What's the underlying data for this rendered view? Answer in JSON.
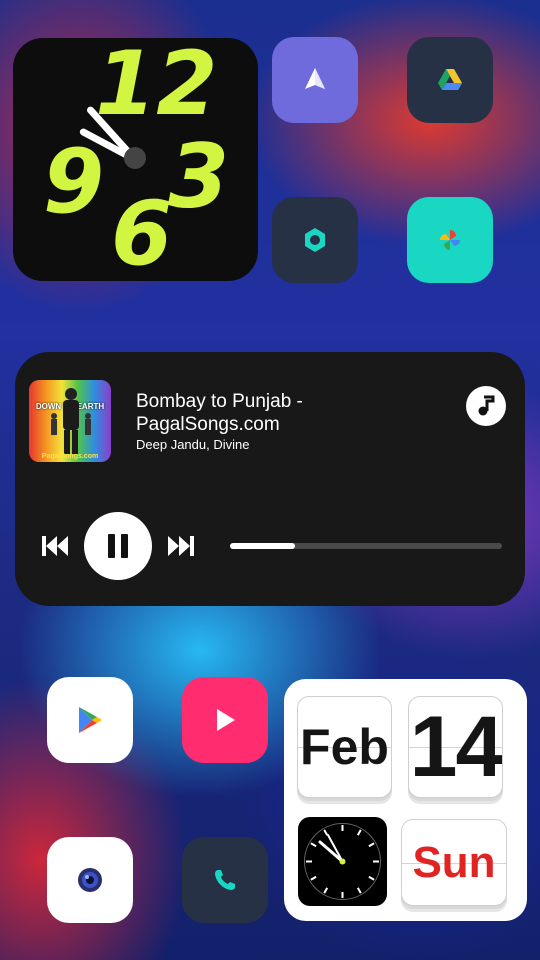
{
  "clock_widget": {
    "numerals": [
      "12",
      "9",
      "6",
      "3"
    ]
  },
  "apps": [
    {
      "name": "paper-plane-app"
    },
    {
      "name": "drive-app"
    },
    {
      "name": "settings-app"
    },
    {
      "name": "photos-app"
    },
    {
      "name": "play-store-app"
    },
    {
      "name": "video-app"
    },
    {
      "name": "camera-app"
    },
    {
      "name": "phone-app"
    }
  ],
  "music": {
    "title": "Bombay to Punjab - PagalSongs.com",
    "artist": "Deep Jandu, Divine",
    "album_art_text": "DOWN TO EARTH",
    "album_art_footer": "PagalSongs.com",
    "progress": 0.24,
    "controls": [
      "skip-previous-icon",
      "pause-icon",
      "skip-next-icon",
      "music-note-icon"
    ]
  },
  "calendar": {
    "month": "Feb",
    "day": "14",
    "weekday": "Sun"
  },
  "colors": {
    "accent_lime": "#d2f542",
    "panel_dark": "#181818",
    "teal": "#1ad7c3",
    "pink": "#ff2d6f",
    "icon_navy": "#263145"
  }
}
